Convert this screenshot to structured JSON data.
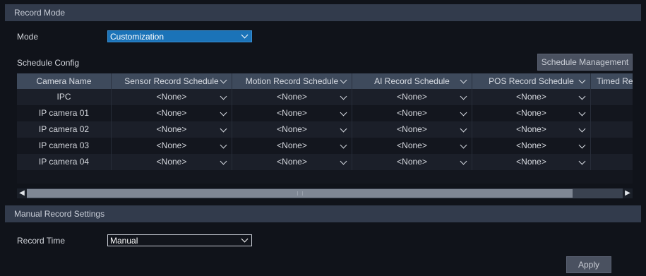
{
  "record_mode": {
    "section_title": "Record Mode",
    "mode_label": "Mode",
    "mode_value": "Customization",
    "schedule_config_label": "Schedule Config",
    "schedule_management_label": "Schedule Management",
    "table": {
      "headers": [
        "Camera Name",
        "Sensor Record Schedule",
        "Motion Record Schedule",
        "AI Record Schedule",
        "POS Record Schedule",
        "Timed Re"
      ],
      "rows": [
        {
          "camera": "IPC",
          "sensor": "<None>",
          "motion": "<None>",
          "ai": "<None>",
          "pos": "<None>"
        },
        {
          "camera": "IP camera 01",
          "sensor": "<None>",
          "motion": "<None>",
          "ai": "<None>",
          "pos": "<None>"
        },
        {
          "camera": "IP camera 02",
          "sensor": "<None>",
          "motion": "<None>",
          "ai": "<None>",
          "pos": "<None>"
        },
        {
          "camera": "IP camera 03",
          "sensor": "<None>",
          "motion": "<None>",
          "ai": "<None>",
          "pos": "<None>"
        },
        {
          "camera": "IP camera 04",
          "sensor": "<None>",
          "motion": "<None>",
          "ai": "<None>",
          "pos": "<None>"
        }
      ]
    }
  },
  "manual_record": {
    "section_title": "Manual Record Settings",
    "record_time_label": "Record Time",
    "record_time_value": "Manual"
  },
  "apply_label": "Apply",
  "colors": {
    "section_bar": "#323b4c",
    "mode_select_bg": "#1b73b8",
    "table_header": "#3e4a5c",
    "background": "#10131a"
  },
  "icons": {
    "dropdown": "chevron-down-icon",
    "scroll_left": "arrow-left-icon",
    "scroll_right": "arrow-right-icon"
  }
}
